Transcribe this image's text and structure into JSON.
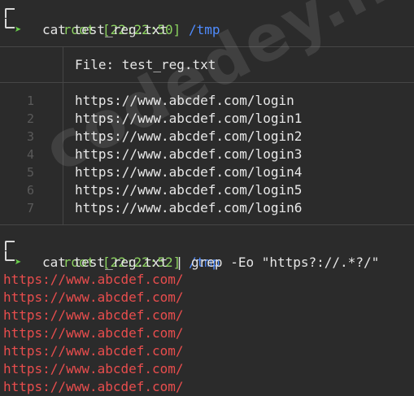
{
  "prompt1": {
    "user": "root",
    "time": "[22:22:50]",
    "path": "/tmp",
    "command": "cat test_reg.txt"
  },
  "file_view": {
    "header": "File: test_reg.txt",
    "line_numbers": [
      "1",
      "2",
      "3",
      "4",
      "5",
      "6",
      "7"
    ],
    "lines": [
      "https://www.abcdef.com/login",
      "https://www.abcdef.com/login1",
      "https://www.abcdef.com/login2",
      "https://www.abcdef.com/login3",
      "https://www.abcdef.com/login4",
      "https://www.abcdef.com/login5",
      "https://www.abcdef.com/login6"
    ]
  },
  "prompt2": {
    "user": "root",
    "time": "[22:22:52]",
    "path": "/tmp",
    "command": "cat test_reg.txt | grep -Eo \"https?://.*?/\""
  },
  "grep_output": [
    "https://www.abcdef.com/",
    "https://www.abcdef.com/",
    "https://www.abcdef.com/",
    "https://www.abcdef.com/",
    "https://www.abcdef.com/",
    "https://www.abcdef.com/",
    "https://www.abcdef.com/"
  ],
  "watermark": "codedey.net",
  "colors": {
    "background": "#2b2b2b",
    "prompt_green": "#8bd25f",
    "path_blue": "#4f8cff",
    "match_red": "#e84d4d",
    "line_number_gray": "#5a5a5a"
  }
}
